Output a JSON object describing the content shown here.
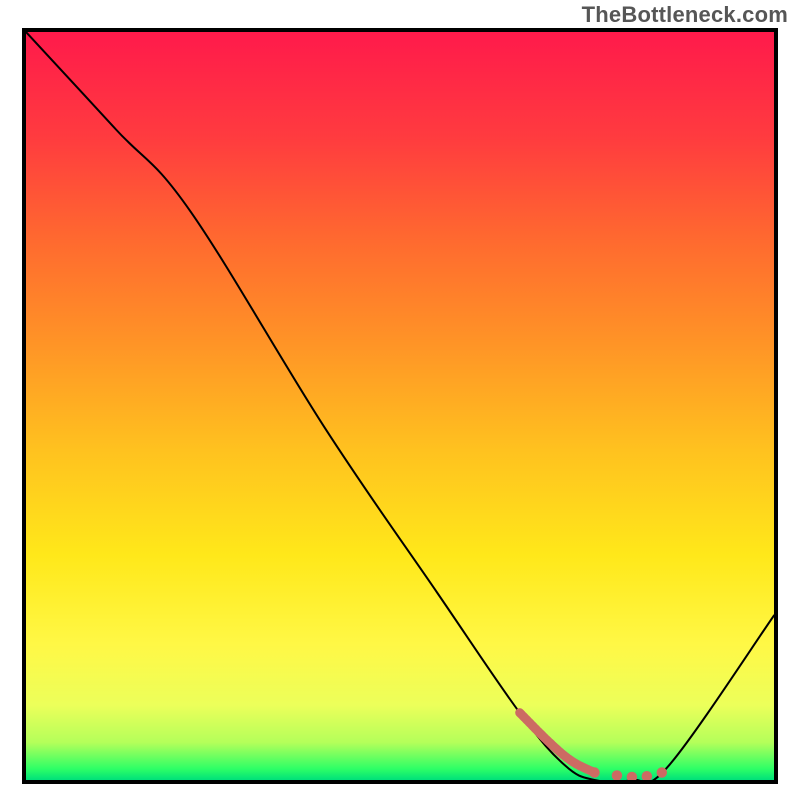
{
  "attribution": "TheBottleneck.com",
  "gradient": {
    "stops": [
      {
        "offset": 0.0,
        "color": "#ff1a4b"
      },
      {
        "offset": 0.14,
        "color": "#ff3b3f"
      },
      {
        "offset": 0.28,
        "color": "#ff6a2f"
      },
      {
        "offset": 0.42,
        "color": "#ff9526"
      },
      {
        "offset": 0.56,
        "color": "#ffc21f"
      },
      {
        "offset": 0.7,
        "color": "#ffe81a"
      },
      {
        "offset": 0.82,
        "color": "#fff846"
      },
      {
        "offset": 0.9,
        "color": "#ecff5a"
      },
      {
        "offset": 0.95,
        "color": "#b4ff5a"
      },
      {
        "offset": 0.985,
        "color": "#2eff66"
      },
      {
        "offset": 1.0,
        "color": "#00e07a"
      }
    ]
  },
  "chart_data": {
    "type": "line",
    "title": "",
    "xlabel": "",
    "ylabel": "",
    "xlim": [
      0,
      100
    ],
    "ylim": [
      0,
      100
    ],
    "grid": false,
    "legend": false,
    "series": [
      {
        "name": "bottleneck-curve",
        "x": [
          0,
          12,
          22,
          40,
          55,
          66,
          72,
          76,
          81,
          86,
          100
        ],
        "y": [
          100,
          87,
          76,
          47,
          25,
          9,
          2,
          0,
          0,
          2,
          22
        ]
      }
    ],
    "highlight_segment": {
      "name": "optimal-range",
      "x": [
        66,
        70,
        73,
        76,
        79,
        81,
        83,
        85
      ],
      "y": [
        9,
        5,
        2.5,
        1,
        0.6,
        0.4,
        0.5,
        1
      ]
    }
  }
}
